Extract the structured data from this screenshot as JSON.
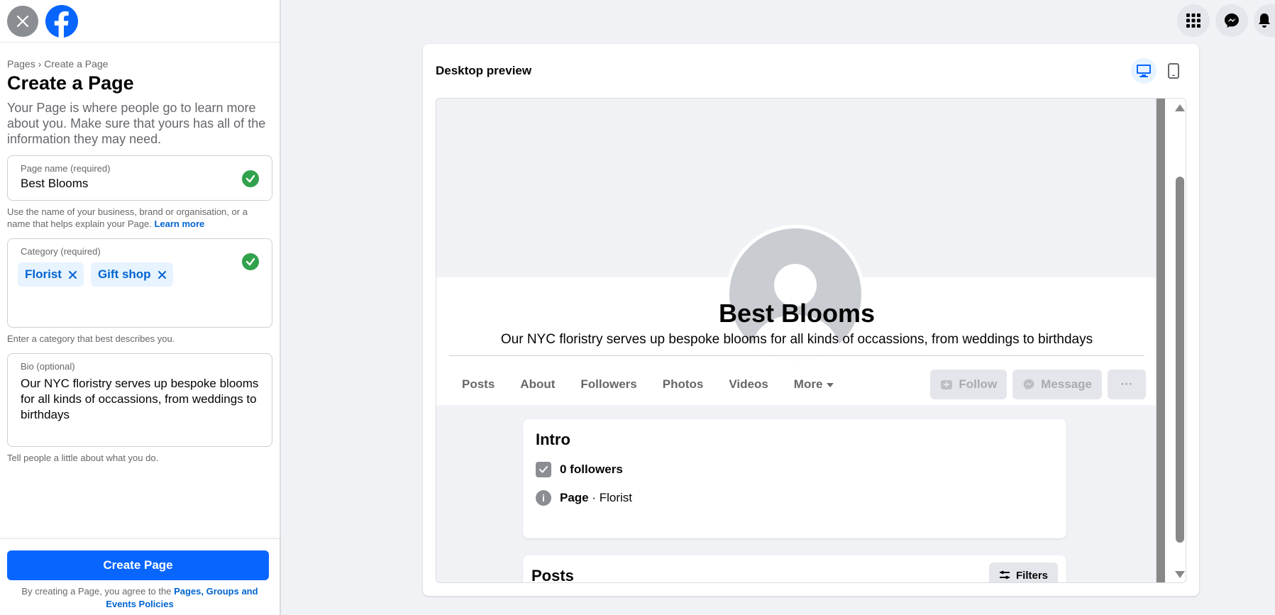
{
  "sidebar": {
    "breadcrumb_root": "Pages",
    "breadcrumb_sep": "›",
    "breadcrumb_current": "Create a Page",
    "title": "Create a Page",
    "description": "Your Page is where people go to learn more about you. Make sure that yours has all of the information they may need.",
    "page_name": {
      "label": "Page name (required)",
      "value": "Best Blooms",
      "help": "Use the name of your business, brand or organisation, or a name that helps explain your Page.",
      "help_link": "Learn more"
    },
    "category": {
      "label": "Category (required)",
      "chips": [
        "Florist",
        "Gift shop"
      ],
      "help": "Enter a category that best describes you."
    },
    "bio": {
      "label": "Bio (optional)",
      "value": "Our NYC floristry serves up bespoke blooms for all kinds of occassions, from weddings to birthdays",
      "help": "Tell people a little about what you do."
    },
    "create_button": "Create Page",
    "terms_prefix": "By creating a Page, you agree to the",
    "terms_link": "Pages, Groups and Events Policies"
  },
  "preview": {
    "title": "Desktop preview",
    "page_name": "Best Blooms",
    "bio": "Our NYC floristry serves up bespoke blooms for all kinds of occassions, from weddings to birthdays",
    "tabs": [
      "Posts",
      "About",
      "Followers",
      "Photos",
      "Videos",
      "More"
    ],
    "actions": {
      "follow": "Follow",
      "message": "Message",
      "more": "···"
    },
    "intro": {
      "title": "Intro",
      "followers": "0 followers",
      "page_label": "Page",
      "page_category": " · Florist"
    },
    "posts": {
      "title": "Posts",
      "filters": "Filters"
    }
  },
  "colors": {
    "brand": "#0866ff",
    "link": "#0064d1",
    "success": "#31a24c",
    "background": "#f0f2f5"
  },
  "icons": [
    "close-icon",
    "facebook-logo",
    "menu-grid-icon",
    "messenger-icon",
    "bell-icon",
    "desktop-icon",
    "mobile-icon",
    "check-icon",
    "remove-chip-icon",
    "follow-icon",
    "messenger-small-icon",
    "followers-icon",
    "info-icon",
    "filters-icon"
  ]
}
